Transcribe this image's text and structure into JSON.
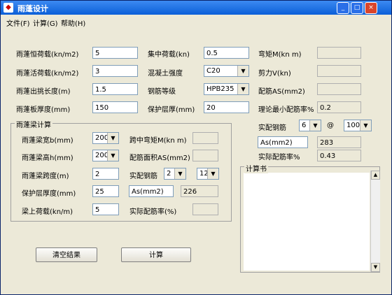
{
  "window": {
    "title": "雨蓬设计"
  },
  "menu": {
    "file": "文件(F)",
    "calc": "计算(G)",
    "help": "帮助(H)"
  },
  "left_form": {
    "dead_load": {
      "label": "雨蓬恒荷载(kn/m2)",
      "value": "5"
    },
    "live_load": {
      "label": "雨蓬活荷载(kn/m2)",
      "value": "3"
    },
    "overhang": {
      "label": "雨蓬出挑长度(m)",
      "value": "1.5"
    },
    "thickness": {
      "label": "雨蓬板厚度(mm)",
      "value": "150"
    }
  },
  "mid_form": {
    "point_load": {
      "label": "集中荷载(kn)",
      "value": "0.5"
    },
    "concrete": {
      "label": "混凝土强度",
      "value": "C20"
    },
    "rebar_grade": {
      "label": "钢筋等级",
      "value": "HPB235"
    },
    "cover": {
      "label": "保护层厚(mm)",
      "value": "20"
    }
  },
  "right_form": {
    "moment": {
      "label": "弯矩M(kn m)",
      "value": ""
    },
    "shear": {
      "label": "剪力V(kn)",
      "value": ""
    },
    "as": {
      "label": "配筋AS(mm2)",
      "value": ""
    },
    "min_ratio": {
      "label": "理论最小配筋率%",
      "value": "0.2"
    },
    "actual_rebar": {
      "label": "实配钢筋",
      "dia": "6",
      "at": "@",
      "spacing": "100"
    },
    "as_actual": {
      "label": "As(mm2)",
      "value": "283"
    },
    "actual_ratio": {
      "label": "实际配筋率%",
      "value": "0.43"
    }
  },
  "beam": {
    "group_title": "雨蓬梁计算",
    "width": {
      "label": "雨蓬梁宽b(mm)",
      "value": "200"
    },
    "height": {
      "label": "雨蓬梁高h(mm)",
      "value": "200"
    },
    "span": {
      "label": "雨蓬梁跨度(m)",
      "value": "2"
    },
    "cover": {
      "label": "保护层厚度(mm)",
      "value": "25"
    },
    "load": {
      "label": "梁上荷载(kn/m)",
      "value": "5"
    },
    "mid_moment": {
      "label": "跨中弯矩M(kn m)",
      "value": ""
    },
    "rebar_area": {
      "label": "配筋面积AS(mm2)",
      "value": ""
    },
    "actual_rebar": {
      "label": "实配钢筋",
      "count": "2",
      "dia": "12"
    },
    "as": {
      "label": "As(mm2)",
      "value": "226"
    },
    "actual_ratio": {
      "label": "实际配筋率(%)",
      "value": ""
    }
  },
  "output": {
    "title": "计算书"
  },
  "buttons": {
    "clear": "清空结果",
    "calc": "计算"
  },
  "titlebar_buttons": {
    "min": "_",
    "max": "□",
    "close": "×"
  }
}
